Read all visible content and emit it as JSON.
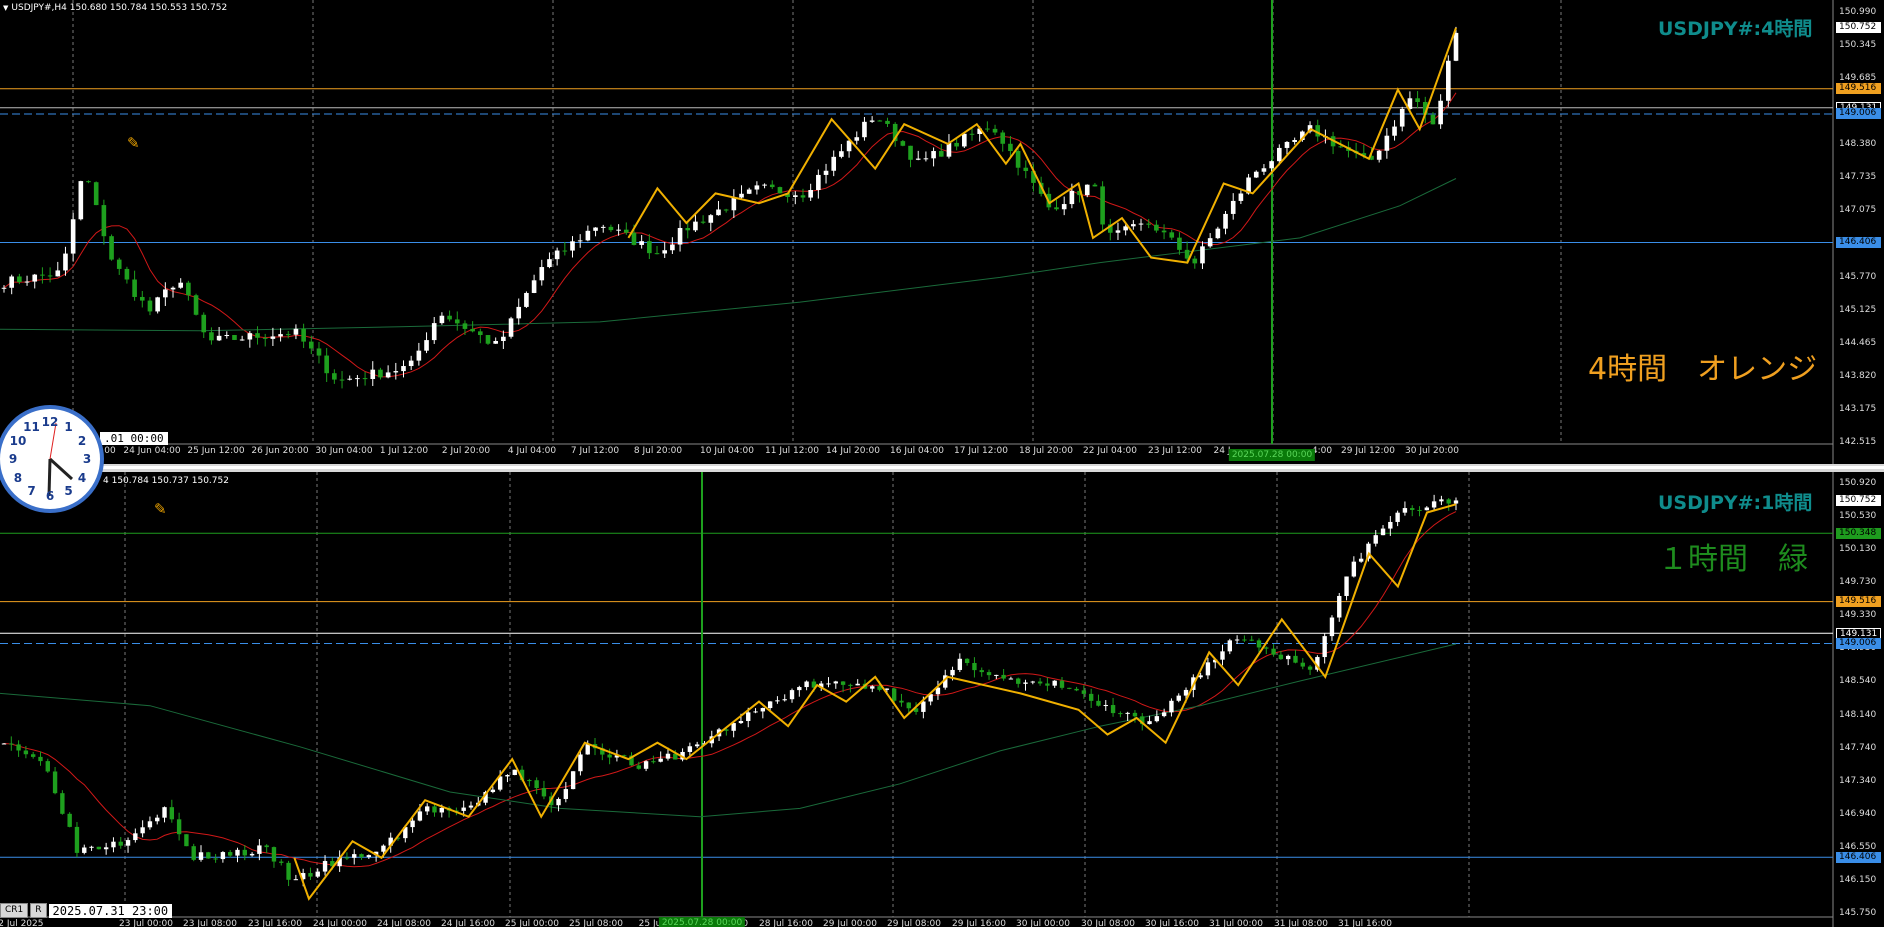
{
  "top": {
    "header": "USDJPY#,H4  150.680 150.784 150.553 150.752",
    "symbol_title": "USDJPY#:4時間",
    "big_label": "4時間　オレンジ",
    "big_label_color": "#f0a020",
    "price_min": 142.35,
    "price_max": 151.17,
    "scale_labels": [
      "150.990",
      "150.345",
      "149.685",
      "149.131",
      "148.380",
      "147.735",
      "147.075",
      "146.430",
      "145.770",
      "145.125",
      "144.465",
      "143.820",
      "143.175",
      "142.515"
    ],
    "boxes": [
      {
        "text": "150.752",
        "price": 150.752,
        "bg": "#ffffff",
        "fg": "#000000"
      },
      {
        "text": "149.516",
        "price": 149.516,
        "bg": "#f0a020",
        "fg": "#000000"
      },
      {
        "text": "149.131",
        "price": 149.131,
        "bg": "#000000",
        "fg": "#ffffff"
      },
      {
        "text": "149.006",
        "price": 149.006,
        "bg": "#3a8ee8",
        "fg": "#000000"
      },
      {
        "text": "146.406",
        "price": 146.406,
        "bg": "#3a8ee8",
        "fg": "#000000"
      }
    ],
    "time_labels": [
      "00",
      "24 Jun 04:00",
      "25 Jun 12:00",
      "26 Jun 20:00",
      "30 Jun 04:00",
      "1 Jul 12:00",
      "2 Jul 20:00",
      "4 Jul 04:00",
      "7 Jul 12:00",
      "8 Jul 20:00",
      "10 Jul 04:00",
      "11 Jul 12:00",
      "14 Jul 20:00",
      "16 Jul 04:00",
      "17 Jul 12:00",
      "18 Jul 20:00",
      "22 Jul 04:00",
      "23 Jul 12:00",
      "24 J",
      "4:00",
      "29 Jul 12:00",
      "30 Jul 20:00"
    ],
    "crosshair_time": "2025.07.28 00:00",
    "date_box": ".01 00:00"
  },
  "bottom": {
    "header": "4 150.784 150.737 150.752",
    "symbol_title": "USDJPY#:1時間",
    "big_label": "１時間　緑",
    "big_label_color": "#1e8c1e",
    "price_min": 145.74,
    "price_max": 151.02,
    "scale_labels": [
      "150.920",
      "150.530",
      "150.130",
      "149.730",
      "149.330",
      "148.930",
      "148.540",
      "148.140",
      "147.740",
      "147.340",
      "146.940",
      "146.550",
      "146.150",
      "145.750"
    ],
    "boxes": [
      {
        "text": "150.752",
        "price": 150.752,
        "bg": "#ffffff",
        "fg": "#000000"
      },
      {
        "text": "150.348",
        "price": 150.348,
        "bg": "#1e9c1e",
        "fg": "#000000"
      },
      {
        "text": "149.516",
        "price": 149.516,
        "bg": "#f0a020",
        "fg": "#000000"
      },
      {
        "text": "149.131",
        "price": 149.131,
        "bg": "#000000",
        "fg": "#ffffff"
      },
      {
        "text": "149.006",
        "price": 149.006,
        "bg": "#3a8ee8",
        "fg": "#000000"
      },
      {
        "text": "146.406",
        "price": 146.406,
        "bg": "#3a8ee8",
        "fg": "#000000"
      }
    ],
    "time_labels": [
      "22 Jul 2025",
      "23 Jul 00:00",
      "23 Jul 08:00",
      "23 Jul 16:00",
      "24 Jul 00:00",
      "24 Jul 08:00",
      "24 Jul 16:00",
      "25 Jul 00:00",
      "25 Jul 08:00",
      "25 Ju",
      "4:00",
      "28 Jul 16:00",
      "29 Jul 00:00",
      "29 Jul 08:00",
      "29 Jul 16:00",
      "30 Jul 00:00",
      "30 Jul 08:00",
      "30 Jul 16:00",
      "31 Jul 00:00",
      "31 Jul 08:00",
      "31 Jul 16:00"
    ],
    "crosshair_time": "2025.07.28 00:00",
    "date_box": "2025.07.31 23:00",
    "toolbar": [
      "CR1",
      "R"
    ]
  },
  "clock": {
    "numbers": [
      "12",
      "1",
      "2",
      "3",
      "4",
      "5",
      "6",
      "7",
      "8",
      "9",
      "10",
      "11"
    ]
  },
  "icons": {
    "pencil": "pencil-icon",
    "clock": "clock-icon"
  },
  "colors": {
    "bull": "#ffffff",
    "bear": "#1ea01e",
    "zigzag": "#f0b000",
    "ma_fast": "#d01818",
    "ma_slow": "#1a6a3a",
    "hline_orange": "#f0a020",
    "hline_blue": "#3a8ee8",
    "crosshair": "#1ea01e"
  }
}
